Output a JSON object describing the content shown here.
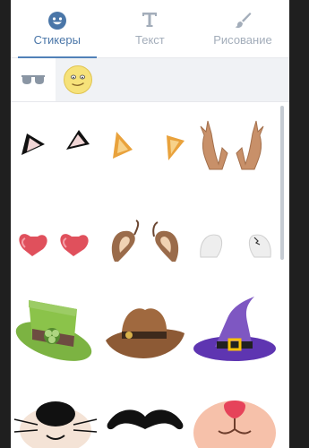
{
  "tabs": [
    {
      "label": "Стикеры",
      "icon": "smile-icon",
      "active": true
    },
    {
      "label": "Текст",
      "icon": "text-icon",
      "active": false
    },
    {
      "label": "Рисование",
      "icon": "brush-icon",
      "active": false
    }
  ],
  "sticker_sets": [
    {
      "icon": "sunglasses-icon",
      "selected": true
    },
    {
      "icon": "smiley-face-icon",
      "selected": false
    }
  ],
  "stickers": [
    "cat-ears-black-sticker",
    "fox-ears-orange-sticker",
    "deer-antlers-sticker",
    "pink-hearts-sticker",
    "dog-ears-brown-sticker",
    "white-ears-sticker",
    "green-leprechaun-hat-sticker",
    "cowboy-hat-sticker",
    "witch-hat-sticker",
    "cat-nose-whiskers-sticker",
    "black-mustache-sticker",
    "pink-animal-muzzle-sticker"
  ],
  "colors": {
    "accent": "#5181b8",
    "tab_inactive": "#a3adba",
    "background": "#1f1f1f"
  }
}
